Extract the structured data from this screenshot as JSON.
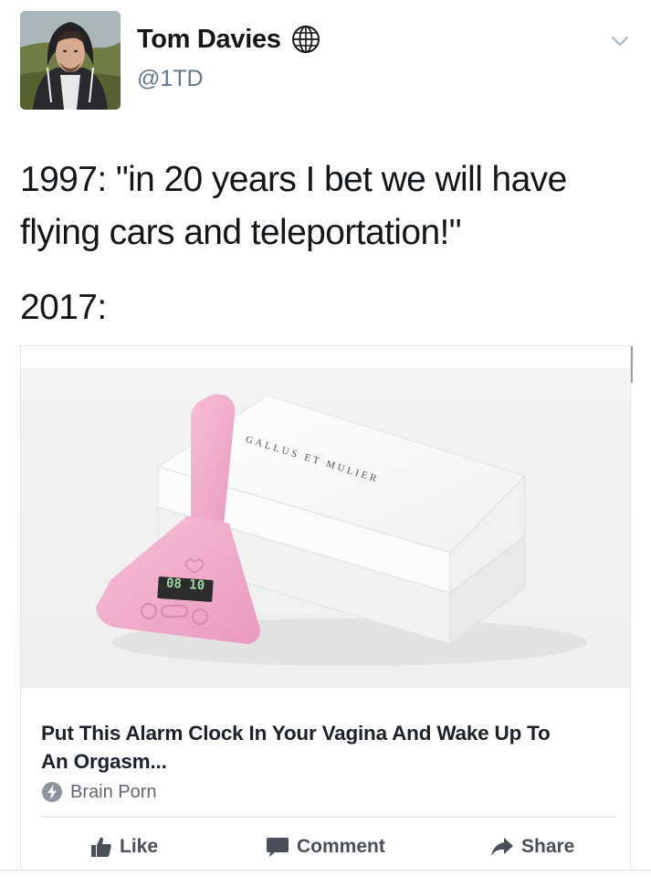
{
  "profile": {
    "name": "Tom Davies",
    "handle": "@1TD",
    "avatar_icon": "profile-photo",
    "badge_icon": "globe-icon",
    "menu_icon": "chevron-down-icon"
  },
  "tweet": {
    "line1": "1997: \"in 20 years I bet we will have",
    "line2": "flying cars and teleportation!\"",
    "line3": "2017:"
  },
  "card": {
    "title_line1": "Put This Alarm Clock In Your Vagina And Wake Up To",
    "title_line2": "An Orgasm...",
    "source": "Brain Porn",
    "source_icon": "lightning-bolt-icon",
    "image": {
      "box_brand": "GALLUS ET MULIER",
      "device_display": "08 10"
    }
  },
  "actions": {
    "like": "Like",
    "comment": "Comment",
    "share": "Share"
  },
  "colors": {
    "text": "#14171a",
    "handle": "#657786",
    "action": "#4b4f56",
    "device_pink": "#f0a9c8"
  }
}
